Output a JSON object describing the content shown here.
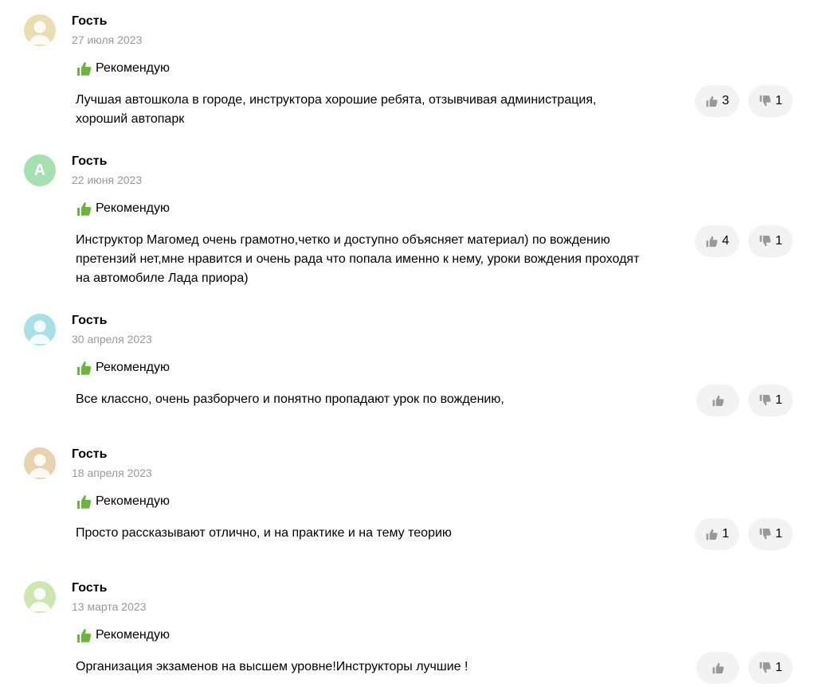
{
  "reviews": [
    {
      "author": "Гость",
      "date": "27 июля 2023",
      "avatar_color": "#e8deb2",
      "avatar_letter": "",
      "recommend": "Рекомендую",
      "text": "Лучшая автошкола в городе, инструктора хорошие ребята, отзывчивая администрация, хороший автопарк",
      "likes": "3",
      "dislikes": "1"
    },
    {
      "author": "Гость",
      "date": "22 июня 2023",
      "avatar_color": "#a6dfb0",
      "avatar_letter": "А",
      "recommend": "Рекомендую",
      "text": "Инструктор Магомед очень грамотно,четко и доступно объясняет материал) по вождению претензий нет,мне нравится и очень рада что попала именно к нему, уроки вождения проходят на автомобиле Лада приора)",
      "likes": "4",
      "dislikes": "1"
    },
    {
      "author": "Гость",
      "date": "30 апреля 2023",
      "avatar_color": "#a9e0e6",
      "avatar_letter": "",
      "recommend": "Рекомендую",
      "text": "Все классно, очень разборчего и понятно пропадают урок по вождению,",
      "likes": "",
      "dislikes": "1"
    },
    {
      "author": "Гость",
      "date": "18 апреля 2023",
      "avatar_color": "#e8d2b0",
      "avatar_letter": "",
      "recommend": "Рекомендую",
      "text": "Просто рассказывают отлично, и на практике и на тему теорию",
      "likes": "1",
      "dislikes": "1"
    },
    {
      "author": "Гость",
      "date": "13 марта 2023",
      "avatar_color": "#cde6b0",
      "avatar_letter": "",
      "recommend": "Рекомендую",
      "text": "Организация экзаменов на высшем уровне!Инструкторы лучшие !",
      "likes": "",
      "dislikes": "1"
    }
  ],
  "colors": {
    "recommend_icon": "#6cb33f",
    "vote_bg": "#f2f2f2",
    "vote_icon": "#999999",
    "date_text": "#999999"
  },
  "icons": {
    "recommend": "thumbs-up-icon",
    "like": "thumbs-up-icon",
    "dislike": "thumbs-down-icon",
    "avatar": "user-silhouette-icon"
  }
}
